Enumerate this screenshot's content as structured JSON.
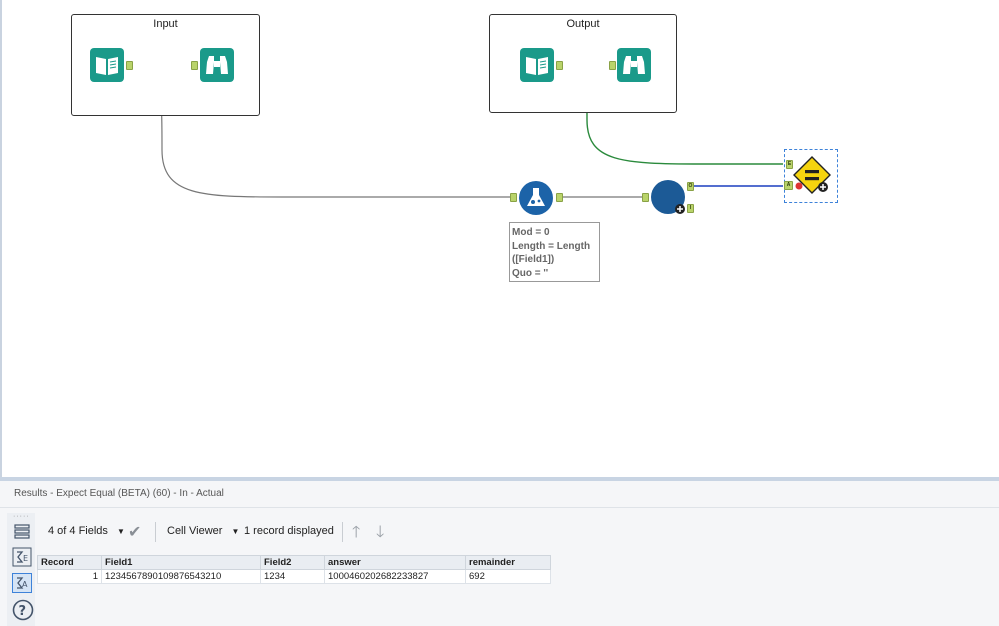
{
  "canvas": {
    "containers": [
      {
        "title": "Input"
      },
      {
        "title": "Output"
      }
    ],
    "annotation": [
      "Mod = 0",
      "Length = Length",
      "([Field1])",
      "Quo = ''"
    ],
    "anchors": {
      "expect_e": "E",
      "expect_a": "A",
      "block_o": "O",
      "block_i": "I"
    },
    "colors": {
      "tool_teal": "#1a9a8a",
      "formula_blue": "#1c63a8",
      "wire_green": "#2a8a3c",
      "wire_blue": "#1b3fbf",
      "wire_gray": "#777777",
      "expect_yellow": "#f5d40f",
      "selection_blue": "#3d82d9"
    }
  },
  "results": {
    "title": "Results - Expect Equal (BETA) (60) - In - Actual",
    "fields_label": "4 of 4 Fields",
    "viewer_label": "Cell Viewer",
    "records_label": "1 record displayed",
    "columns": [
      "Record",
      "Field1",
      "Field2",
      "answer",
      "remainder"
    ],
    "rows": [
      [
        "1",
        "1234567890109876543210",
        "1234",
        "1000460202682233827",
        "692"
      ]
    ]
  }
}
